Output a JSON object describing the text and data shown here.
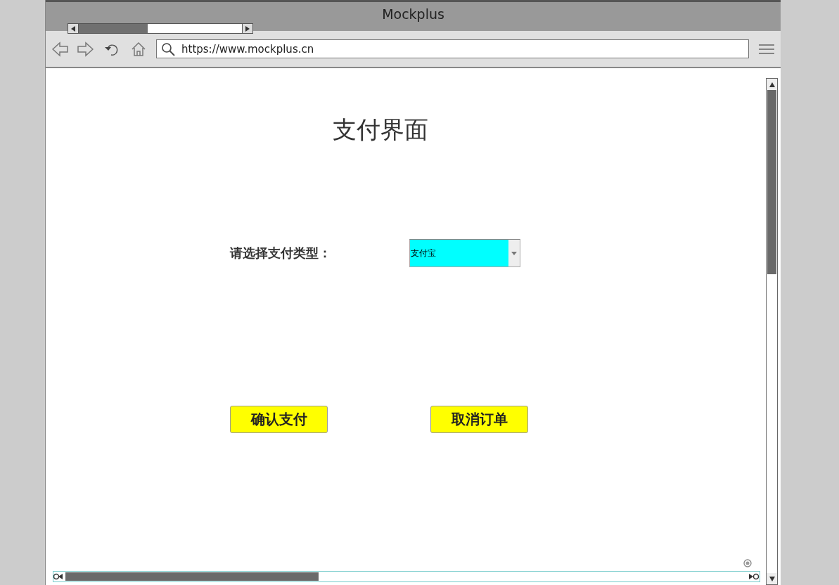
{
  "window": {
    "title": "Mockplus"
  },
  "address_bar": {
    "url": "https://www.mockplus.cn"
  },
  "page": {
    "title": "支付界面",
    "payment_type": {
      "label": "请选择支付类型：",
      "value": "支付宝"
    },
    "buttons": [
      {
        "label": "确认支付"
      },
      {
        "label": "取消订单"
      }
    ]
  }
}
